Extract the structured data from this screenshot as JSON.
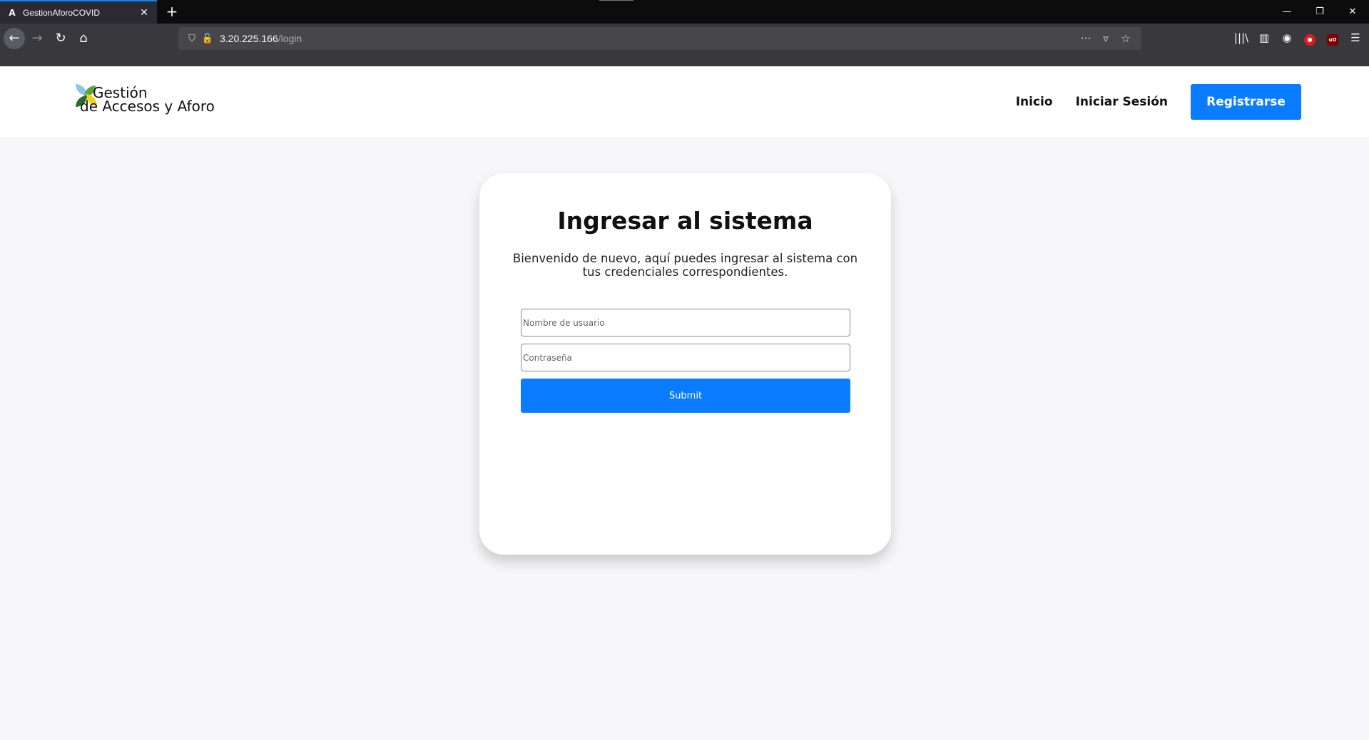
{
  "browser": {
    "tab": {
      "favicon": "A",
      "title": "GestionAforoCOVID",
      "close": "✕"
    },
    "new_tab": "+",
    "window_controls": {
      "minimize": "—",
      "restore": "❐",
      "close": "✕"
    },
    "nav": {
      "back": "←",
      "forward": "→",
      "reload": "↻",
      "home": "⌂"
    },
    "url": {
      "host": "3.20.225.166",
      "path": "/login"
    },
    "url_icons": {
      "shield": "⛉",
      "insecure": "🔓"
    },
    "url_actions": {
      "more": "···",
      "pocket": "▿",
      "bookmark": "☆"
    },
    "toolbar": {
      "library": "|||\\",
      "sidebar": "▥",
      "account": "◉",
      "ext1": "●",
      "ublock": "uO",
      "menu": "☰"
    }
  },
  "site": {
    "logo": {
      "line1": "Gestión",
      "line2": "de Accesos y Aforo"
    },
    "nav": {
      "inicio": "Inicio",
      "iniciar_sesion": "Iniciar Sesión",
      "registrarse": "Registrarse"
    }
  },
  "login": {
    "title": "Ingresar al sistema",
    "subtitle": "Bienvenido de nuevo, aquí puedes ingresar al sistema con tus credenciales correspondientes.",
    "username_placeholder": "Nombre de usuario",
    "password_placeholder": "Contraseña",
    "submit_label": "Submit"
  },
  "colors": {
    "accent": "#0a7cff",
    "page_bg": "#f7f7f9"
  }
}
